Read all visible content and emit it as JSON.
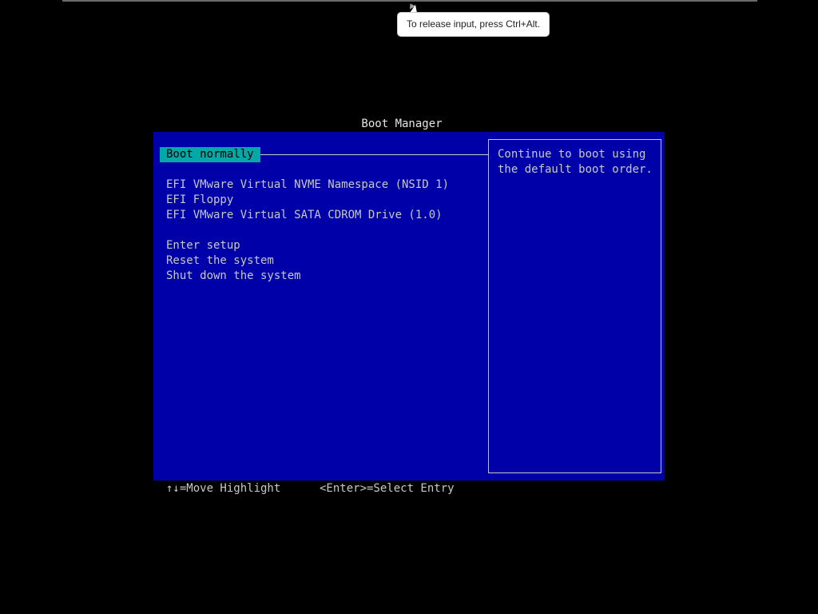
{
  "tooltip": {
    "text": "To release input, press Ctrl+Alt."
  },
  "boot_manager": {
    "title": "Boot Manager",
    "entries": [
      {
        "label": "Boot normally",
        "selected": true
      },
      {
        "label": "EFI VMware Virtual NVME Namespace (NSID 1)"
      },
      {
        "label": "EFI Floppy"
      },
      {
        "label": "EFI VMware Virtual SATA CDROM Drive (1.0)"
      },
      {
        "label": "Enter setup"
      },
      {
        "label": "Reset the system"
      },
      {
        "label": "Shut down the system"
      }
    ],
    "help_lines": [
      "Continue to boot using",
      "the default boot order."
    ]
  },
  "footer": {
    "move_hint": "↑↓=Move Highlight",
    "select_hint": "<Enter>=Select Entry"
  },
  "colors": {
    "background": "#000000",
    "panel": "#0000a8",
    "highlight": "#00a8a8",
    "text": "#c8c8c8"
  }
}
